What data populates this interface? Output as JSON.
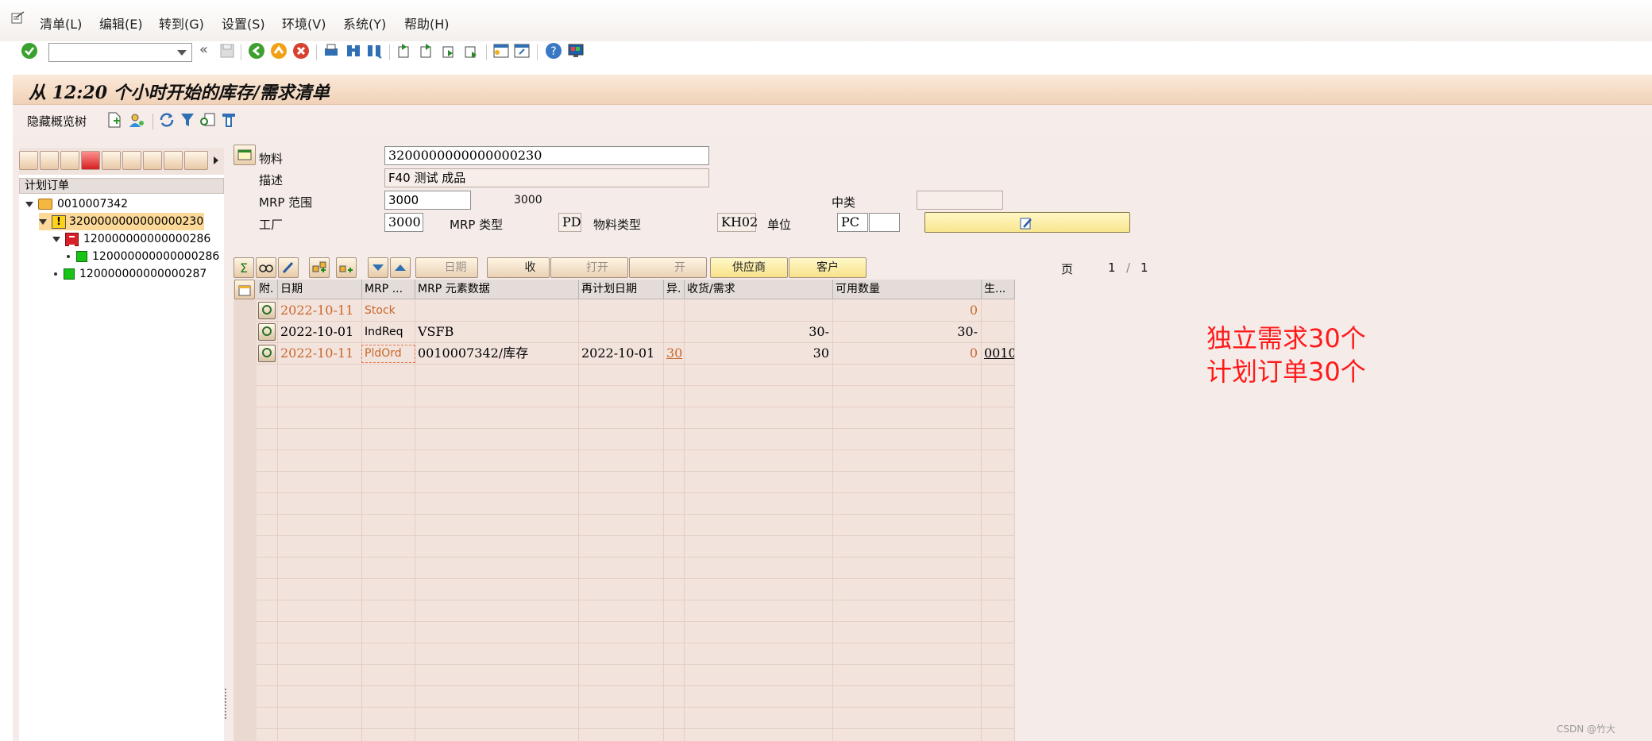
{
  "menu": {
    "items": [
      "清单(L)",
      "编辑(E)",
      "转到(G)",
      "设置(S)",
      "环境(V)",
      "系统(Y)",
      "帮助(H)"
    ]
  },
  "toolbar": {
    "command_field": "",
    "nav_back": "«"
  },
  "title": "从 12:20 个小时开始的库存/需求清单",
  "app_toolbar": {
    "hide_tree_label": "隐藏概览树"
  },
  "tree": {
    "header": "计划订单",
    "nodes": [
      {
        "label": "0010007342",
        "level": 0,
        "kind": "folder",
        "expanded": true
      },
      {
        "label": "3200000000000000230",
        "level": 1,
        "kind": "warning",
        "expanded": true,
        "selected": true
      },
      {
        "label": "120000000000000286",
        "level": 2,
        "kind": "red",
        "expanded": true
      },
      {
        "label": "120000000000000286",
        "level": 3,
        "kind": "green"
      },
      {
        "label": "120000000000000287",
        "level": 2,
        "kind": "green"
      }
    ]
  },
  "header": {
    "material_label": "物料",
    "material_value": "3200000000000000230",
    "desc_label": "描述",
    "desc_value": "F40 测试 成品",
    "mrp_area_label": "MRP 范围",
    "mrp_area_value": "3000",
    "mrp_area_text": "3000",
    "category_label": "中类",
    "category_value": "",
    "plant_label": "工厂",
    "plant_value": "3000",
    "mrp_type_label": "MRP 类型",
    "mrp_type_value": "PD",
    "material_type_label": "物料类型",
    "material_type_value": "KH02",
    "unit_label": "单位",
    "unit_value": "PC",
    "unit_extra": ""
  },
  "grid_toolbar": {
    "date_btn": "日期",
    "receipt_btn": "收",
    "open_btn": "打开",
    "open2_btn": "开",
    "vendor_btn": "供应商",
    "customer_btn": "客户",
    "page_label": "页",
    "page_current": "1",
    "page_sep": "/",
    "page_total": "1"
  },
  "grid": {
    "columns": [
      "附.",
      "日期",
      "MRP ...",
      "MRP 元素数据",
      "再计划日期",
      "异.",
      "收货/需求",
      "可用数量",
      "生..."
    ],
    "rows": [
      {
        "date": "2022-10-11",
        "mrp": "Stock",
        "data": "",
        "resched": "",
        "exc": "",
        "qty": "",
        "avail": "0",
        "prod": "",
        "color": "orange"
      },
      {
        "date": "2022-10-01",
        "mrp": "IndReq",
        "data": "VSFB",
        "resched": "",
        "exc": "",
        "qty": "30-",
        "avail": "30-",
        "prod": "",
        "color": "black"
      },
      {
        "date": "2022-10-11",
        "mrp": "PldOrd",
        "data": "0010007342/库存",
        "resched": "2022-10-01",
        "exc": "30",
        "qty": "30",
        "avail": "0",
        "prod": "0010",
        "color": "orange"
      }
    ]
  },
  "annotation": {
    "line1": "独立需求30个",
    "line2": "计划订单30个"
  },
  "watermark": "CSDN @竹大"
}
